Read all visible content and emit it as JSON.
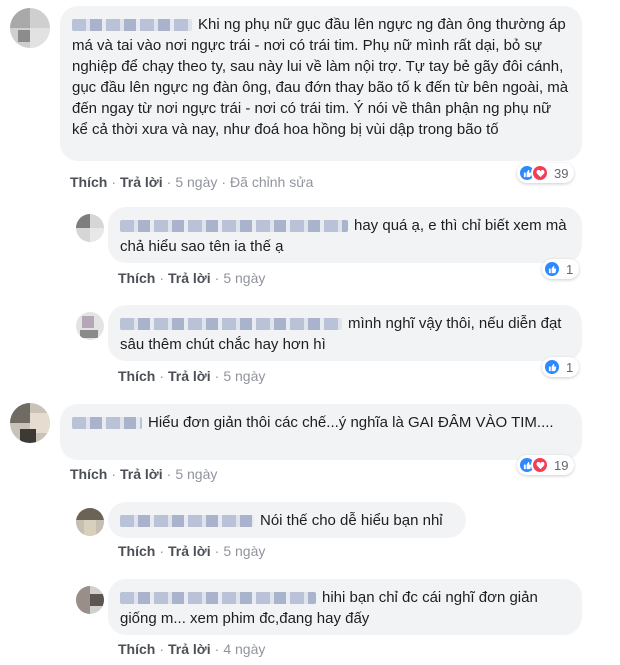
{
  "comments": [
    {
      "text": "Khi ng phụ nữ gục đầu lên ngực ng đàn ông thường áp má và tai vào nơi ngực trái - nơi có trái tim. Phụ nữ mình rất dại, bỏ sự nghiệp để chạy theo ty, sau này lui về làm nội trợ. Tự tay bẻ gãy đôi cánh, gục đầu lên ngực ng đàn ông, đau đớn thay bão tố k đến từ bên ngoài, mà đến ngay từ nơi ngực trái - nơi có trái tim. Ý nói về thân phận ng phụ nữ kể cả thời xưa và nay, như đoá hoa hồng bị vùi dập trong bão tố",
      "like": "Thích",
      "reply": "Trả lời",
      "time": "5 ngày",
      "edited": "Đã chỉnh sửa",
      "count": "39"
    },
    {
      "text": "hay quá ạ, e thì chỉ biết xem mà chả hiểu sao tên ia thế ạ",
      "like": "Thích",
      "reply": "Trả lời",
      "time": "5 ngày",
      "count": "1"
    },
    {
      "text": "mình nghĩ vậy thôi, nếu diễn đạt sâu thêm chút chắc hay hơn hì",
      "like": "Thích",
      "reply": "Trả lời",
      "time": "5 ngày",
      "count": "1"
    },
    {
      "text": "Hiểu đơn giản thôi các chế...ý nghĩa là GAI ĐÂM VÀO TIM....",
      "like": "Thích",
      "reply": "Trả lời",
      "time": "5 ngày",
      "count": "19"
    },
    {
      "text": "Nói thế cho dễ hiểu bạn nhỉ",
      "like": "Thích",
      "reply": "Trả lời",
      "time": "5 ngày"
    },
    {
      "text": "hihi bạn chỉ đc cái nghĩ đơn giản giống m... xem phim đc,đang hay đấy",
      "like": "Thích",
      "reply": "Trả lời",
      "time": "4 ngày"
    }
  ],
  "colors": {
    "like": "#2e89ff",
    "love": "#f33e58",
    "bubble": "#f2f3f5",
    "action": "#4b4f56"
  },
  "icons": {
    "like": "like-icon",
    "love": "love-icon"
  }
}
